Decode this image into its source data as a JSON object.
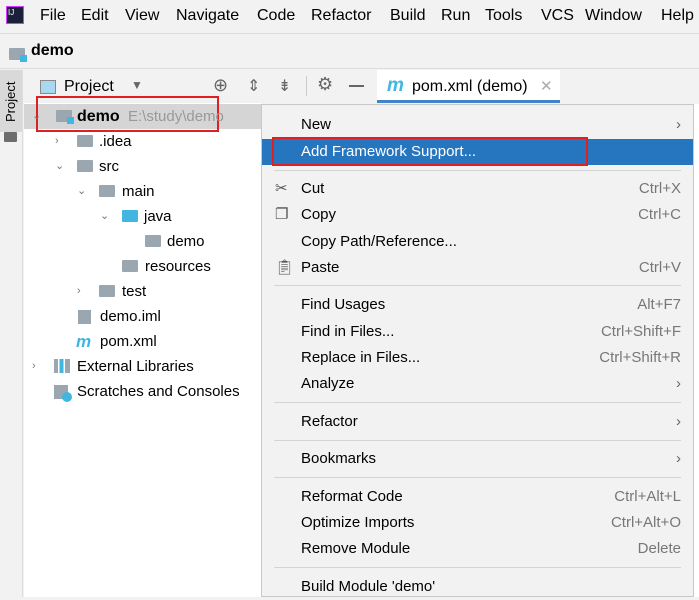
{
  "menubar": {
    "items": [
      "File",
      "Edit",
      "View",
      "Navigate",
      "Code",
      "Refactor",
      "Build",
      "Run",
      "Tools",
      "VCS",
      "Window",
      "Help"
    ]
  },
  "navbar": {
    "project": "demo"
  },
  "stripe": {
    "label": "Project"
  },
  "panel": {
    "selector": "Project"
  },
  "tab": {
    "label": "pom.xml (demo)",
    "icon_letter": "m"
  },
  "tree": [
    {
      "label": "demo",
      "hint": "E:\\study\\demo"
    },
    {
      "label": ".idea"
    },
    {
      "label": "src"
    },
    {
      "label": "main"
    },
    {
      "label": "java"
    },
    {
      "label": "demo"
    },
    {
      "label": "resources"
    },
    {
      "label": "test"
    },
    {
      "label": "demo.iml"
    },
    {
      "label": "pom.xml"
    },
    {
      "label": "External Libraries"
    },
    {
      "label": "Scratches and Consoles"
    }
  ],
  "menu": [
    {
      "label": "New",
      "sub": true
    },
    {
      "label": "Add Framework Support..."
    },
    {
      "label": "Cut",
      "key": "Ctrl+X"
    },
    {
      "label": "Copy",
      "key": "Ctrl+C"
    },
    {
      "label": "Copy Path/Reference..."
    },
    {
      "label": "Paste",
      "key": "Ctrl+V"
    },
    {
      "label": "Find Usages",
      "key": "Alt+F7"
    },
    {
      "label": "Find in Files...",
      "key": "Ctrl+Shift+F"
    },
    {
      "label": "Replace in Files...",
      "key": "Ctrl+Shift+R"
    },
    {
      "label": "Analyze",
      "sub": true
    },
    {
      "label": "Refactor",
      "sub": true
    },
    {
      "label": "Bookmarks",
      "sub": true
    },
    {
      "label": "Reformat Code",
      "key": "Ctrl+Alt+L"
    },
    {
      "label": "Optimize Imports",
      "key": "Ctrl+Alt+O"
    },
    {
      "label": "Remove Module",
      "key": "Delete"
    },
    {
      "label": "Build Module 'demo'"
    }
  ]
}
